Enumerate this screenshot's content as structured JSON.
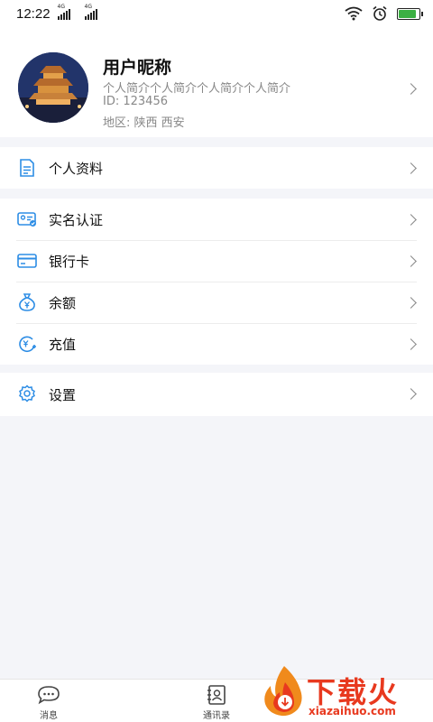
{
  "status_bar": {
    "time": "12:22",
    "sim1_tag": "4G",
    "sim2_tag": "4G",
    "icons": [
      "signal-icon",
      "signal-icon",
      "wifi-icon",
      "alarm-icon",
      "battery-icon"
    ],
    "battery_level": 0.85
  },
  "profile": {
    "name": "用户昵称",
    "bio": "个人简介个人简介个人简介个人简介",
    "id": "ID: 123456",
    "region": "地区: 陕西 西安"
  },
  "menu": {
    "personal_info": "个人资料",
    "real_name_auth": "实名认证",
    "bank_card": "银行卡",
    "balance": "余额",
    "recharge": "充值",
    "settings": "设置"
  },
  "colors": {
    "accent": "#2d8de5",
    "background": "#f4f5f9",
    "watermark": "#e8391f"
  },
  "tab_bar": {
    "messages": "消息",
    "contacts": "通讯录"
  },
  "watermark": {
    "brand": "下载火",
    "domain": "xiazaihuo.com"
  }
}
